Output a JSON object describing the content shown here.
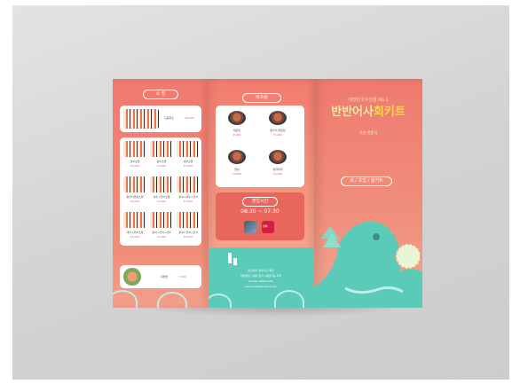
{
  "panel_left": {
    "header_pill": "소 장",
    "top_item": {
      "name": "모둠회초",
      "price": "18,000"
    },
    "grid": [
      {
        "name": "연어초밥",
        "price": "13,000"
      },
      {
        "name": "광어초밥",
        "price": "13,000"
      },
      {
        "name": "새우초밥",
        "price": "13,000"
      },
      {
        "name": "황새치뱃살초밥",
        "price": "13,000"
      },
      {
        "name": "새우+연어초밥",
        "price": "13,000"
      },
      {
        "name": "광어+새우+연어",
        "price": "13,000"
      },
      {
        "name": "새우+유부초밥",
        "price": "15,000"
      },
      {
        "name": "광어+연어+새우",
        "price": "16,000"
      },
      {
        "name": "광어+연어+참치",
        "price": "16,000"
      }
    ],
    "bottom_item": {
      "name": "회덮밥",
      "price": "7,000"
    }
  },
  "panel_middle": {
    "header_pill": "비조림",
    "bowls": [
      {
        "name": "매운탕",
        "price": "9,000"
      },
      {
        "name": "통우리 매운탕",
        "price": "15,000"
      },
      {
        "name": "알탕",
        "price": "13,000"
      },
      {
        "name": "동태찌개",
        "price": "10,000"
      }
    ],
    "hours_pill": "영업시간",
    "hours": "08:30 ~ 07:30",
    "order_badge": "참배",
    "footer_lines": [
      "반찬에서 영업시간 확인",
      "주문방법 | 예약 문의 | 배달가능 지역",
      "Mobile 1668-1234",
      "www.example-store.com"
    ]
  },
  "panel_right": {
    "subtitle": "대한민국수산물 No.1",
    "title_main": "반반어사",
    "title_accent": "회키트",
    "tagline": "수산 전문식",
    "categories_pill": "회 / 초밥 / 밀키트"
  },
  "colors": {
    "coral": "#f07a70",
    "teal": "#5ccab8",
    "cream_title": "#f7e6a2",
    "accent_title": "#f9d84a"
  }
}
